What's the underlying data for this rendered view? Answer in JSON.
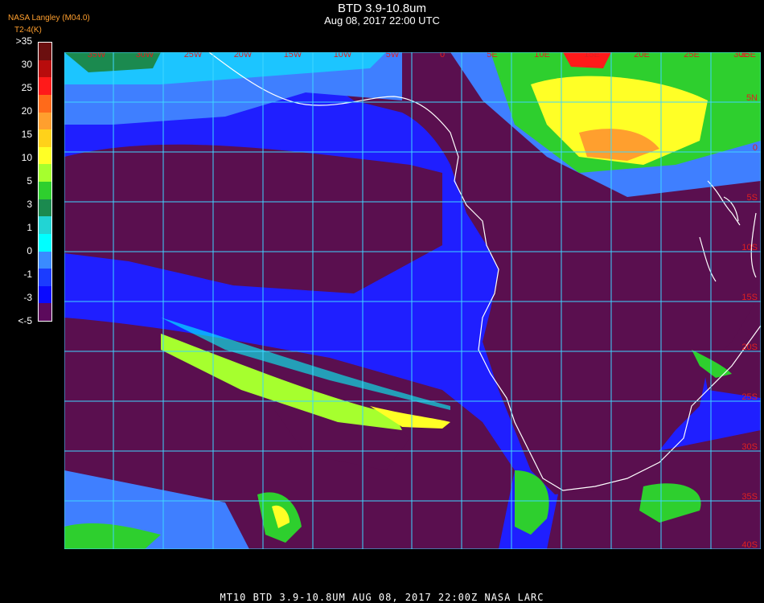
{
  "title": "BTD 3.9-10.8um",
  "timestamp": "Aug 08, 2017 22:00 UTC",
  "org_label": "NASA Langley (M04.0)",
  "unit_label": "T2-4(K)",
  "colorbar": {
    "labels": [
      ">35",
      "30",
      "25",
      "20",
      "15",
      "10",
      "5",
      "3",
      "1",
      "0",
      "-1",
      "-3",
      "<-5"
    ],
    "colors": [
      "#6b0f0f",
      "#b80c0c",
      "#ff1a1a",
      "#ff6a1a",
      "#ff9f2e",
      "#ffd21a",
      "#ffff26",
      "#a6ff2e",
      "#2ecf2e",
      "#1b8a4f",
      "#22d4d4",
      "#00ffff",
      "#3a8bff",
      "#1b3cff",
      "#0a0aff",
      "#5c0a5c"
    ]
  },
  "map": {
    "longitude_labels": [
      "35W",
      "30W",
      "25W",
      "20W",
      "15W",
      "10W",
      "5W",
      "0",
      "5E",
      "10E",
      "15E",
      "20E",
      "25E",
      "30E",
      "35E"
    ],
    "latitude_labels": [
      "5N",
      "0",
      "5S",
      "10S",
      "15S",
      "20S",
      "25S",
      "30S",
      "35S",
      "40S"
    ],
    "colors": {
      "grid": "#3fd6ff",
      "coast": "#ffffff",
      "label": "#e02020",
      "land": "#5a0f4f",
      "ocean": "#1f1fff",
      "ocean_light": "#3f7fff"
    }
  },
  "footer": "MT10  BTD 3.9-10.8UM   AUG 08, 2017 22:00Z  NASA LARC"
}
